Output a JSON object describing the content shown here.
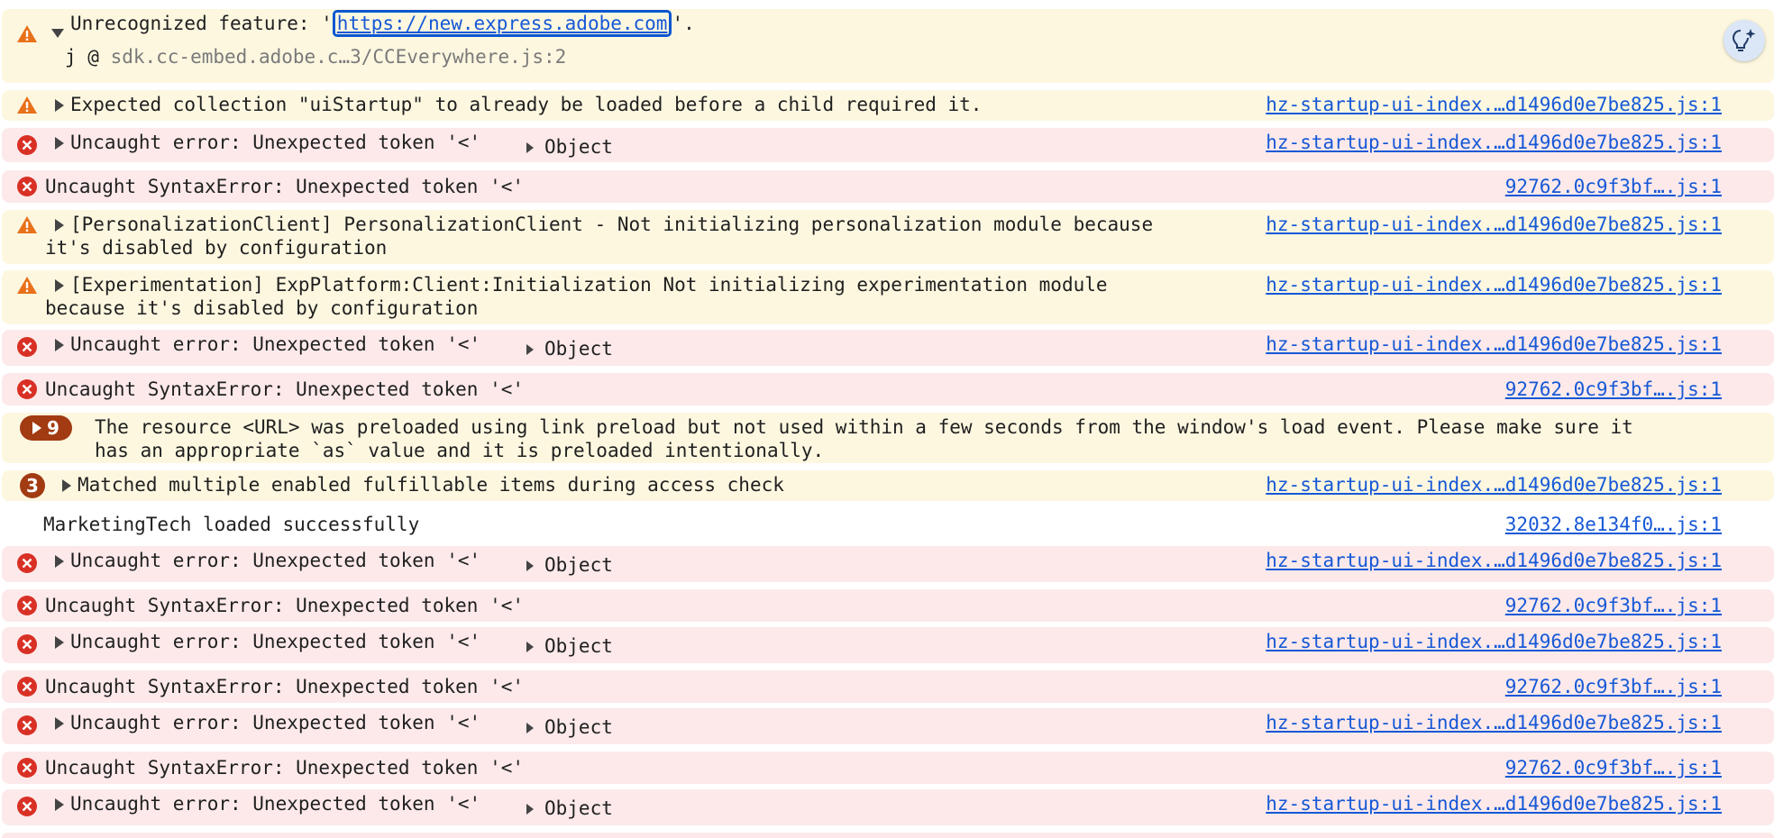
{
  "colors": {
    "warning_bg": "#fdf7e0",
    "error_bg": "#fde9ea",
    "warning_icon": "#e8711a",
    "error_icon": "#d93025",
    "link": "#1558d6",
    "badge": "#a23b12"
  },
  "hint_button": {
    "icon": "lightbulb-sparkle-icon"
  },
  "messages": [
    {
      "level": "warning",
      "icon": "warning-icon",
      "expanded": true,
      "text_before": "Unrecognized feature: '",
      "link": "https://new.express.adobe.com",
      "text_after": "'.",
      "stack_prefix": "j @ ",
      "stack_source": "sdk.cc-embed.adobe.c…3/CCEverywhere.js:2"
    },
    {
      "level": "warning",
      "icon": "warning-icon",
      "text": "Expected collection \"uiStartup\" to already be loaded before a child required it.",
      "source": "hz-startup-ui-index.…d1496d0e7be825.js:1"
    },
    {
      "level": "error",
      "icon": "error-icon",
      "text": "Uncaught error: Unexpected token '<'",
      "object": "Object",
      "source": "hz-startup-ui-index.…d1496d0e7be825.js:1"
    },
    {
      "level": "error",
      "icon": "error-icon",
      "text": "Uncaught SyntaxError: Unexpected token '<'",
      "source": "92762.0c9f3bf….js:1"
    },
    {
      "level": "warning",
      "icon": "warning-icon",
      "text_line1": "[PersonalizationClient] PersonalizationClient - Not initializing personalization module because",
      "text_line2": "it's disabled by configuration",
      "source": "hz-startup-ui-index.…d1496d0e7be825.js:1"
    },
    {
      "level": "warning",
      "icon": "warning-icon",
      "text_line1": "[Experimentation] ExpPlatform:Client:Initialization Not initializing experimentation module",
      "text_line2": "because it's disabled by configuration",
      "source": "hz-startup-ui-index.…d1496d0e7be825.js:1"
    },
    {
      "level": "error",
      "icon": "error-icon",
      "text": "Uncaught error: Unexpected token '<'",
      "object": "Object",
      "source": "hz-startup-ui-index.…d1496d0e7be825.js:1"
    },
    {
      "level": "error",
      "icon": "error-icon",
      "text": "Uncaught SyntaxError: Unexpected token '<'",
      "source": "92762.0c9f3bf….js:1"
    },
    {
      "level": "warning",
      "badge": "9",
      "text_line1": "The resource <URL> was preloaded using link preload but not used within a few seconds from the window's load event. Please make sure it",
      "text_line2": "has an appropriate `as` value and it is preloaded intentionally."
    },
    {
      "level": "warning",
      "badge": "3",
      "text": "Matched multiple enabled fulfillable items during access check",
      "source": "hz-startup-ui-index.…d1496d0e7be825.js:1"
    },
    {
      "level": "info",
      "text": "MarketingTech loaded successfully",
      "source": "32032.8e134f0….js:1"
    },
    {
      "level": "error",
      "icon": "error-icon",
      "text": "Uncaught error: Unexpected token '<'",
      "object": "Object",
      "source": "hz-startup-ui-index.…d1496d0e7be825.js:1"
    },
    {
      "level": "error",
      "icon": "error-icon",
      "text": "Uncaught SyntaxError: Unexpected token '<'",
      "source": "92762.0c9f3bf….js:1"
    },
    {
      "level": "error",
      "icon": "error-icon",
      "text": "Uncaught error: Unexpected token '<'",
      "object": "Object",
      "source": "hz-startup-ui-index.…d1496d0e7be825.js:1"
    },
    {
      "level": "error",
      "icon": "error-icon",
      "text": "Uncaught SyntaxError: Unexpected token '<'",
      "source": "92762.0c9f3bf….js:1"
    },
    {
      "level": "error",
      "icon": "error-icon",
      "text": "Uncaught error: Unexpected token '<'",
      "object": "Object",
      "source": "hz-startup-ui-index.…d1496d0e7be825.js:1"
    },
    {
      "level": "error",
      "icon": "error-icon",
      "text": "Uncaught SyntaxError: Unexpected token '<'",
      "source": "92762.0c9f3bf….js:1"
    },
    {
      "level": "error",
      "icon": "error-icon",
      "text": "Uncaught error: Unexpected token '<'",
      "object": "Object",
      "source": "hz-startup-ui-index.…d1496d0e7be825.js:1"
    }
  ]
}
